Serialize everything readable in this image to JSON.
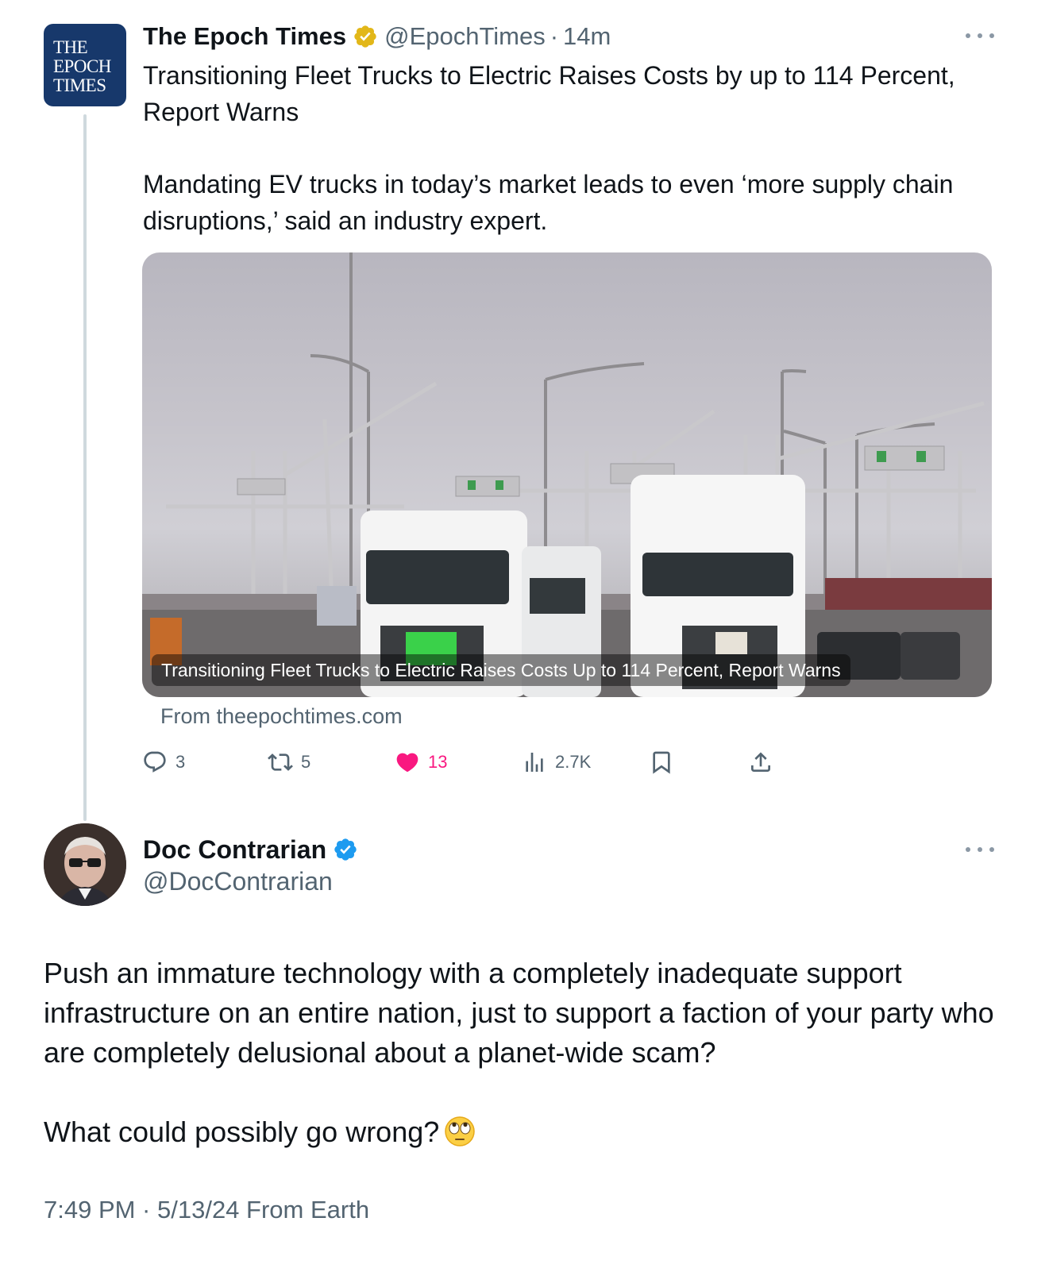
{
  "parent_tweet": {
    "author_name": "The Epoch Times",
    "author_handle": "@EpochTimes",
    "separator": "·",
    "time_ago": "14m",
    "logo_lines": [
      "THE",
      "EPOCH",
      "TIMES"
    ],
    "headline": "Transitioning Fleet Trucks to Electric Raises Costs by up to 114 Percent, Report Warns",
    "subtext": "Mandating EV trucks in today’s market leads to even ‘more supply chain disruptions,’ said an industry expert.",
    "card": {
      "caption": "Transitioning Fleet Trucks to Electric Raises Costs Up to 114 Percent, Report Warns",
      "source": "From theepochtimes.com",
      "image_icon": "port-trucks-photo"
    },
    "metrics": {
      "replies": "3",
      "reposts": "5",
      "likes": "13",
      "views": "2.7K"
    },
    "liked": true
  },
  "reply_tweet": {
    "author_name": "Doc Contrarian",
    "author_handle": "@DocContrarian",
    "verified_badge": "blue-check-icon",
    "text_paragraph_1": "Push an immature technology with a completely inadequate support infrastructure on an entire nation, just to support a faction of your party who are completely delusional about a planet-wide scam?",
    "text_paragraph_2": "What could possibly go wrong?",
    "emoji": "eye-roll-emoji",
    "timestamp": "7:49 PM · 5/13/24 From Earth"
  },
  "colors": {
    "text": "#0f1419",
    "secondary": "#536471",
    "like": "#f91880",
    "verified_blue": "#1d9bf0",
    "verified_gold": "#e2b719",
    "epoch_navy": "#17386b"
  }
}
